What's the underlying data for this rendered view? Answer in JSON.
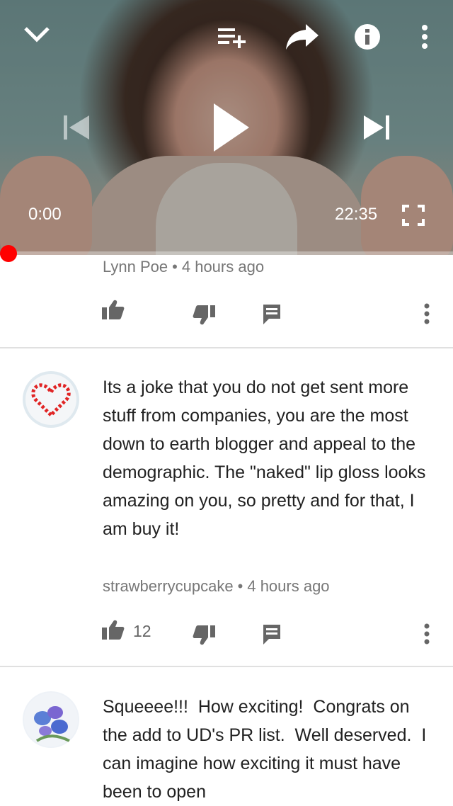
{
  "player": {
    "current_time": "0:00",
    "duration": "22:35",
    "progress": 0,
    "icons": [
      "chevron-down-icon",
      "add-to-playlist-icon",
      "share-icon",
      "info-icon",
      "more-vert-icon",
      "previous-icon",
      "play-icon",
      "next-icon",
      "fullscreen-icon"
    ]
  },
  "comments": [
    {
      "author": "Lynn Poe",
      "time": "4 hours ago",
      "likes": ""
    },
    {
      "text": "Its a joke that you do not get sent more stuff from companies, you are the most down to earth blogger and appeal to the demographic. The \"naked\" lip gloss looks amazing on you, so pretty and for that, I am buy it!",
      "author": "strawberrycupcake",
      "time": "4 hours ago",
      "likes": "12"
    },
    {
      "text": "Squeeee!!!  How exciting!  Congrats on the add to UD's PR list.  Well deserved.  I can imagine how exciting it must have been to open"
    }
  ],
  "colors": {
    "progress": "#ff0000",
    "meta_text": "#777777",
    "body_text": "#212121"
  }
}
